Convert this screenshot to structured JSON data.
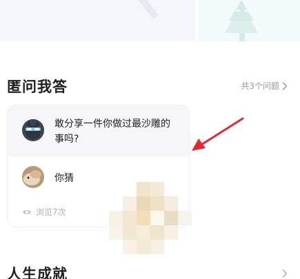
{
  "qa_section": {
    "title": "匿问我答",
    "more_link": "共3个问题",
    "card": {
      "question": "敢分享一件你做过最沙雕的事吗?",
      "answer": "你猜",
      "views": "浏览7次"
    }
  },
  "achievements_section": {
    "title": "人生成就"
  },
  "colors": {
    "annotation_arrow": "#e8262f",
    "question_bg": "#f6f6f8",
    "muted_text": "#9a9a9a"
  },
  "icons": [
    "chevron-right-icon",
    "eye-icon",
    "tree-icon"
  ]
}
